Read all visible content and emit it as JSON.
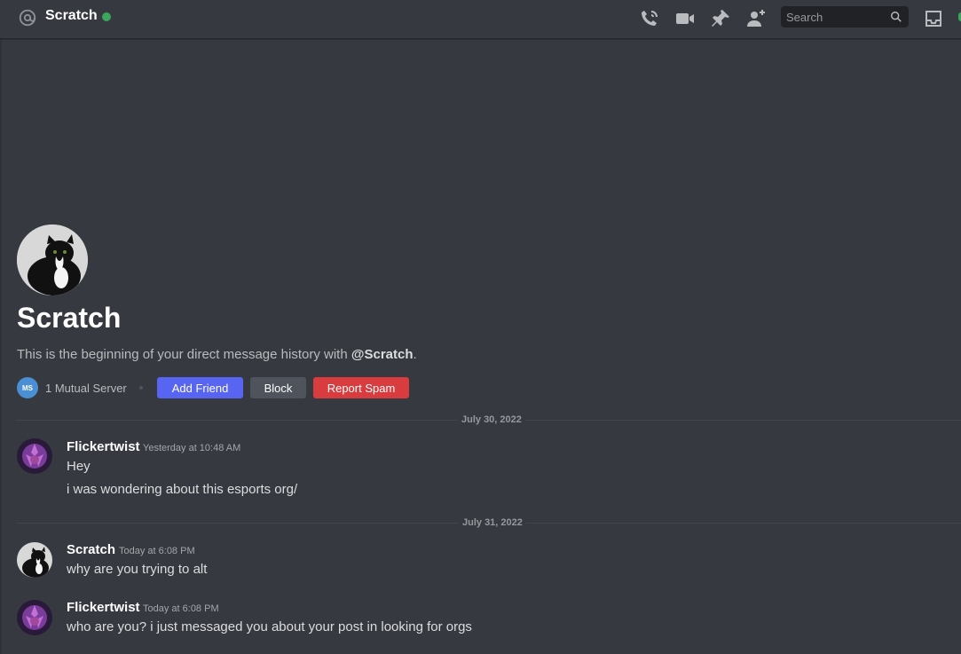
{
  "header": {
    "title": "Scratch",
    "status_color": "#3ba55d",
    "search_placeholder": "Search",
    "icons": [
      "at-sign-icon",
      "voice-call-icon",
      "video-call-icon",
      "pin-icon",
      "add-friend-icon",
      "search-icon",
      "inbox-icon"
    ]
  },
  "profile": {
    "name": "Scratch",
    "intro_prefix": "This is the beginning of your direct message history with ",
    "intro_mention": "@Scratch",
    "intro_suffix": ".",
    "mutual_server_initials": "MS",
    "mutual_servers": "1 Mutual Server",
    "add_friend": "Add Friend",
    "block": "Block",
    "report_spam": "Report Spam"
  },
  "dividers": [
    "July 30, 2022",
    "July 31, 2022"
  ],
  "messages": [
    {
      "author": "Flickertwist",
      "time": "Yesterday at 10:48 AM",
      "lines": [
        "Hey",
        "i was wondering about this esports org/"
      ]
    },
    {
      "author": "Scratch",
      "time": "Today at 6:08 PM",
      "lines": [
        "why are you trying to alt"
      ]
    },
    {
      "author": "Flickertwist",
      "time": "Today at 6:08 PM",
      "lines": [
        "who are you? i just messaged you about your post in looking for orgs"
      ]
    }
  ],
  "colors": {
    "blurple": "#5865f2",
    "danger": "#d83c3e",
    "secondary": "#4f545c",
    "background": "#36393f"
  }
}
